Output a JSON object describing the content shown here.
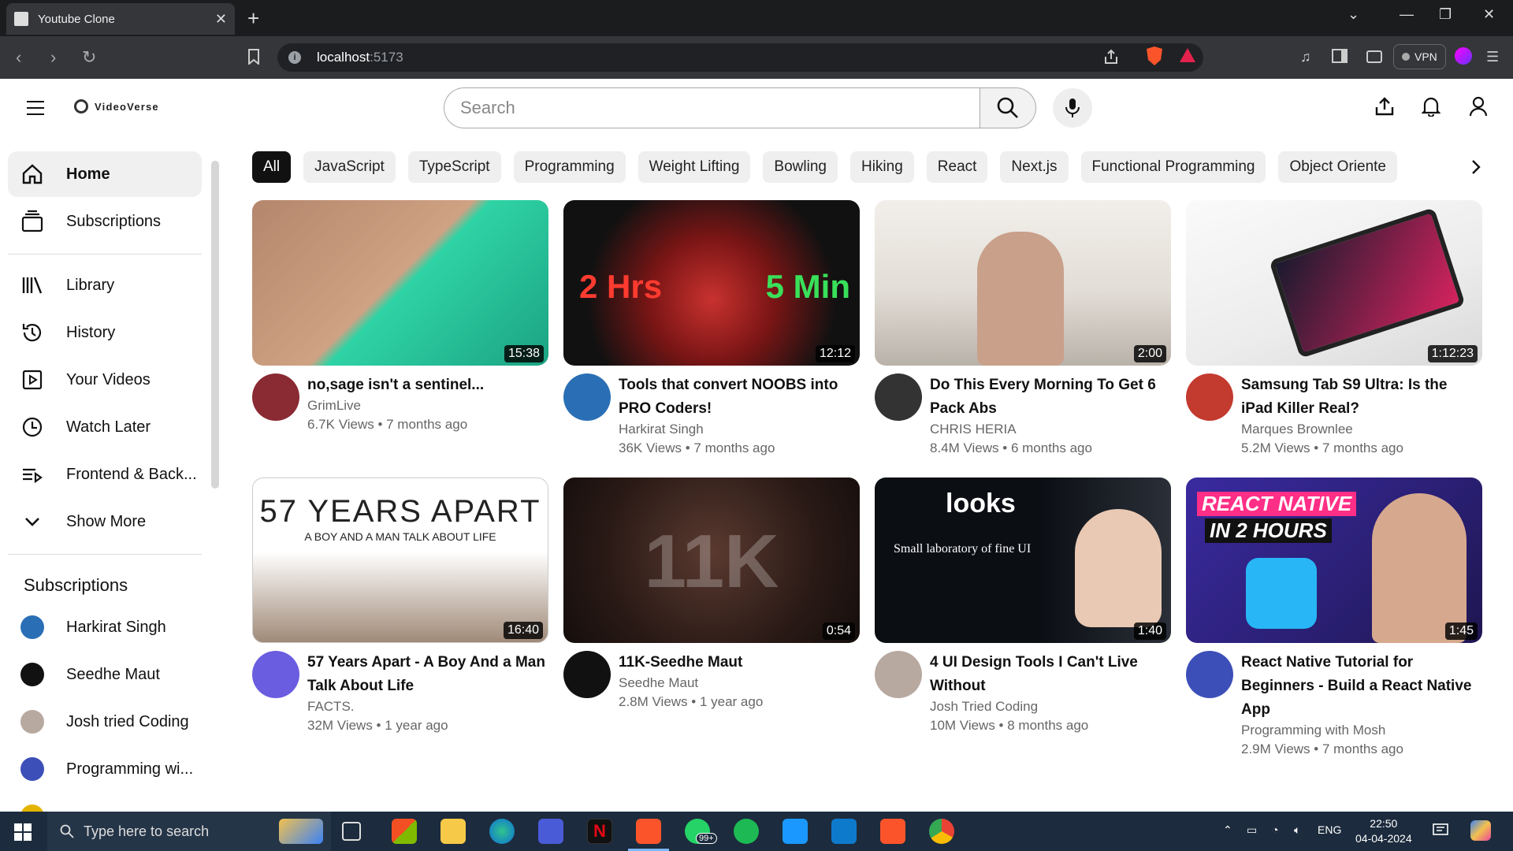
{
  "browser": {
    "tab_title": "Youtube Clone",
    "url_host": "localhost",
    "url_port": ":5173",
    "vpn_label": "VPN"
  },
  "app": {
    "logo_text": "VideoVerse",
    "search_placeholder": "Search"
  },
  "sidebar": {
    "main": [
      {
        "label": "Home",
        "icon": "home-icon",
        "active": true
      },
      {
        "label": "Subscriptions",
        "icon": "subscriptions-icon"
      }
    ],
    "library": [
      {
        "label": "Library",
        "icon": "library-icon"
      },
      {
        "label": "History",
        "icon": "history-icon"
      },
      {
        "label": "Your Videos",
        "icon": "your-videos-icon"
      },
      {
        "label": "Watch Later",
        "icon": "watch-later-icon"
      },
      {
        "label": "Frontend & Back...",
        "icon": "playlist-icon"
      },
      {
        "label": "Show More",
        "icon": "chevron-down-icon"
      }
    ],
    "subscriptions_heading": "Subscriptions",
    "subscriptions": [
      {
        "label": "Harkirat Singh",
        "color": "#2a6fb5"
      },
      {
        "label": "Seedhe Maut",
        "color": "#111111"
      },
      {
        "label": "Josh tried Coding",
        "color": "#b8a9a0"
      },
      {
        "label": "Programming wi...",
        "color": "#3c4fb8"
      }
    ]
  },
  "chips": [
    "All",
    "JavaScript",
    "TypeScript",
    "Programming",
    "Weight Lifting",
    "Bowling",
    "Hiking",
    "React",
    "Next.js",
    "Functional Programming",
    "Object Oriente"
  ],
  "videos": [
    {
      "title": "no,sage isn't a sentinel...",
      "channel": "GrimLive",
      "stats": "6.7K Views • 7 months ago",
      "duration": "15:38",
      "thumb_colors": [
        "#c99a78",
        "#2fd3a5"
      ],
      "avatar_color": "#8a2a33"
    },
    {
      "title": "Tools that convert NOOBS into PRO Coders!",
      "channel": "Harkirat Singh",
      "stats": "36K Views • 7 months ago",
      "duration": "12:12",
      "thumb_colors": [
        "#111111",
        "#d32222"
      ],
      "thumb_text_left": "2 Hrs",
      "thumb_text_right": "5 Min",
      "avatar_color": "#2a6fb5"
    },
    {
      "title": "Do This Every Morning To Get 6 Pack Abs",
      "channel": "CHRIS HERIA",
      "stats": "8.4M Views • 6 months ago",
      "duration": "2:00",
      "thumb_colors": [
        "#e9e6e1",
        "#333333"
      ],
      "avatar_color": "#333333"
    },
    {
      "title": "Samsung Tab S9 Ultra: Is the iPad Killer Real?",
      "channel": "Marques Brownlee",
      "stats": "5.2M Views • 7 months ago",
      "duration": "1:12:23",
      "thumb_colors": [
        "#f2f2f2",
        "#d5235e"
      ],
      "avatar_color": "#c33a2f"
    },
    {
      "title": "57 Years Apart - A Boy And a Man Talk About Life",
      "channel": "FACTS.",
      "stats": "32M Views • 1 year ago",
      "duration": "16:40",
      "thumb_colors": [
        "#ffffff",
        "#6b4b3a"
      ],
      "thumb_text_main": "57 YEARS APART",
      "thumb_text_sub": "A BOY AND A MAN TALK ABOUT LIFE",
      "avatar_color": "#6a5de0"
    },
    {
      "title": "11K-Seedhe Maut",
      "channel": "Seedhe Maut",
      "stats": "2.8M Views • 1 year ago",
      "duration": "0:54",
      "thumb_colors": [
        "#3a2621",
        "#1d1412"
      ],
      "thumb_text_main": "11K",
      "avatar_color": "#111111"
    },
    {
      "title": "4 UI Design Tools I Can't Live Without",
      "channel": "Josh Tried Coding",
      "stats": "10M Views • 8 months ago",
      "duration": "1:40",
      "thumb_colors": [
        "#0b0e13",
        "#e9c9b4"
      ],
      "thumb_text_main": "looks",
      "thumb_text_sub": "Small laboratory of fine UI",
      "avatar_color": "#b8a9a0"
    },
    {
      "title": "React Native Tutorial for Beginners - Build a React Native App",
      "channel": "Programming with Mosh",
      "stats": "2.9M Views • 7 months ago",
      "duration": "1:45",
      "thumb_colors": [
        "#2a1f73",
        "#ff2e86"
      ],
      "thumb_text_main": "REACT NATIVE",
      "thumb_text_sub": "IN 2 HOURS",
      "avatar_color": "#3c4fb8"
    }
  ],
  "taskbar": {
    "search_placeholder": "Type here to search",
    "language": "ENG",
    "time": "22:50",
    "date": "04-04-2024",
    "badge": "99+"
  }
}
